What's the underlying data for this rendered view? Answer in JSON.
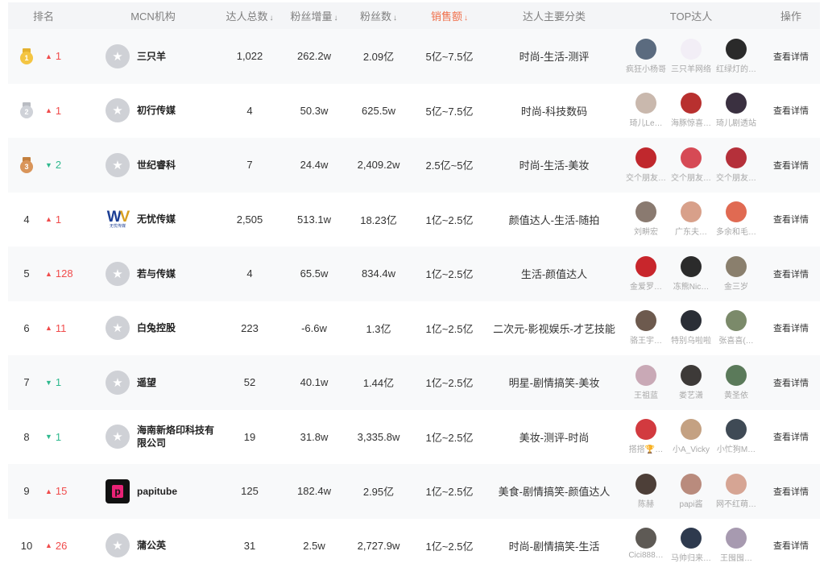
{
  "columns": {
    "rank": "排名",
    "mcn": "MCN机构",
    "talent_total": "达人总数",
    "fan_growth": "粉丝增量",
    "fans": "粉丝数",
    "sales": "销售额",
    "category": "达人主要分类",
    "top": "TOP达人",
    "op": "操作",
    "sort_arrow": "↓"
  },
  "colors": {
    "accent": "#f06e49",
    "up": "#f04b4b",
    "down": "#2fb98e"
  },
  "icon_glyph": {
    "default_logo": "★",
    "trend_up": "▲",
    "trend_down": "▼"
  },
  "rows": [
    {
      "rank": "1",
      "medal": "gold",
      "trend_dir": "up",
      "trend": "1",
      "logo": "default",
      "name": "三只羊",
      "talent_total": "1,022",
      "fan_growth": "262.2w",
      "fans": "2.09亿",
      "sales": "5亿~7.5亿",
      "category": "时尚-生活-测评",
      "op": "查看详情",
      "top": [
        {
          "name": "疯狂小杨哥",
          "color": "#5b6b7f"
        },
        {
          "name": "三只羊网络",
          "color": "#f2eef6"
        },
        {
          "name": "红绿灯的…",
          "color": "#2a2a2a"
        }
      ]
    },
    {
      "rank": "2",
      "medal": "silver",
      "trend_dir": "up",
      "trend": "1",
      "logo": "default",
      "name": "初行传媒",
      "talent_total": "4",
      "fan_growth": "50.3w",
      "fans": "625.5w",
      "sales": "5亿~7.5亿",
      "category": "时尚-科技数码",
      "op": "查看详情",
      "top": [
        {
          "name": "琦儿Le…",
          "color": "#c9b8ad"
        },
        {
          "name": "海豚惊喜…",
          "color": "#b8302f"
        },
        {
          "name": "琦儿剧透站",
          "color": "#3a3040"
        }
      ]
    },
    {
      "rank": "3",
      "medal": "bronze",
      "trend_dir": "down",
      "trend": "2",
      "logo": "default",
      "name": "世纪睿科",
      "talent_total": "7",
      "fan_growth": "24.4w",
      "fans": "2,409.2w",
      "sales": "2.5亿~5亿",
      "category": "时尚-生活-美妆",
      "op": "查看详情",
      "top": [
        {
          "name": "交个朋友…",
          "color": "#c0282d"
        },
        {
          "name": "交个朋友…",
          "color": "#d64a55"
        },
        {
          "name": "交个朋友…",
          "color": "#b5303a"
        }
      ]
    },
    {
      "rank": "4",
      "medal": "",
      "trend_dir": "up",
      "trend": "1",
      "logo": "wuyou",
      "name": "无忧传媒",
      "talent_total": "2,505",
      "fan_growth": "513.1w",
      "fans": "18.23亿",
      "sales": "1亿~2.5亿",
      "category": "颜值达人-生活-随拍",
      "op": "查看详情",
      "top": [
        {
          "name": "刘畊宏",
          "color": "#8a7a70"
        },
        {
          "name": "广东夫…",
          "color": "#d8a08a"
        },
        {
          "name": "多余和毛…",
          "color": "#e06a52"
        }
      ]
    },
    {
      "rank": "5",
      "medal": "",
      "trend_dir": "up",
      "trend": "128",
      "logo": "default",
      "name": "若与传媒",
      "talent_total": "4",
      "fan_growth": "65.5w",
      "fans": "834.4w",
      "sales": "1亿~2.5亿",
      "category": "生活-颜值达人",
      "op": "查看详情",
      "top": [
        {
          "name": "金爱罗…",
          "color": "#c8262c"
        },
        {
          "name": "冻熊Nic…",
          "color": "#2b2b2b"
        },
        {
          "name": "金三岁",
          "color": "#8a7f6d"
        }
      ]
    },
    {
      "rank": "6",
      "medal": "",
      "trend_dir": "up",
      "trend": "11",
      "logo": "default",
      "name": "白兔控股",
      "talent_total": "223",
      "fan_growth": "-6.6w",
      "fans": "1.3亿",
      "sales": "1亿~2.5亿",
      "category": "二次元-影视娱乐-才艺技能",
      "op": "查看详情",
      "top": [
        {
          "name": "骆王宇…",
          "color": "#6d5a4e"
        },
        {
          "name": "特别乌啦啦",
          "color": "#2a2e36"
        },
        {
          "name": "张喜喜(…",
          "color": "#7b8a6a"
        }
      ]
    },
    {
      "rank": "7",
      "medal": "",
      "trend_dir": "down",
      "trend": "1",
      "logo": "default",
      "name": "遥望",
      "talent_total": "52",
      "fan_growth": "40.1w",
      "fans": "1.44亿",
      "sales": "1亿~2.5亿",
      "category": "明星-剧情搞笑-美妆",
      "op": "查看详情",
      "top": [
        {
          "name": "王祖蓝",
          "color": "#c9a9b6"
        },
        {
          "name": "娄艺潇",
          "color": "#3d3a38"
        },
        {
          "name": "黄圣依",
          "color": "#5b7a5a"
        }
      ]
    },
    {
      "rank": "8",
      "medal": "",
      "trend_dir": "down",
      "trend": "1",
      "logo": "default",
      "name": "海南新烙印科技有限公司",
      "talent_total": "19",
      "fan_growth": "31.8w",
      "fans": "3,335.8w",
      "sales": "1亿~2.5亿",
      "category": "美妆-测评-时尚",
      "op": "查看详情",
      "top": [
        {
          "name": "搭搭🏆…",
          "color": "#d23a3f"
        },
        {
          "name": "小A_Vicky",
          "color": "#c4a182"
        },
        {
          "name": "小忙狗M…",
          "color": "#3f4a55"
        }
      ]
    },
    {
      "rank": "9",
      "medal": "",
      "trend_dir": "up",
      "trend": "15",
      "logo": "papi",
      "name": "papitube",
      "talent_total": "125",
      "fan_growth": "182.4w",
      "fans": "2.95亿",
      "sales": "1亿~2.5亿",
      "category": "美食-剧情搞笑-颜值达人",
      "op": "查看详情",
      "top": [
        {
          "name": "陈赫",
          "color": "#4d3f38"
        },
        {
          "name": "papi酱",
          "color": "#b98b7d"
        },
        {
          "name": "网不红萌…",
          "color": "#d6a594"
        }
      ]
    },
    {
      "rank": "10",
      "medal": "",
      "trend_dir": "up",
      "trend": "26",
      "logo": "default",
      "name": "蒲公英",
      "talent_total": "31",
      "fan_growth": "2.5w",
      "fans": "2,727.9w",
      "sales": "1亿~2.5亿",
      "category": "时尚-剧情搞笑-生活",
      "op": "查看详情",
      "top": [
        {
          "name": "Cici888…",
          "color": "#5e5a55"
        },
        {
          "name": "马帅归来…",
          "color": "#2e3a4e"
        },
        {
          "name": "王囤囤…",
          "color": "#a79ab0"
        }
      ]
    }
  ]
}
